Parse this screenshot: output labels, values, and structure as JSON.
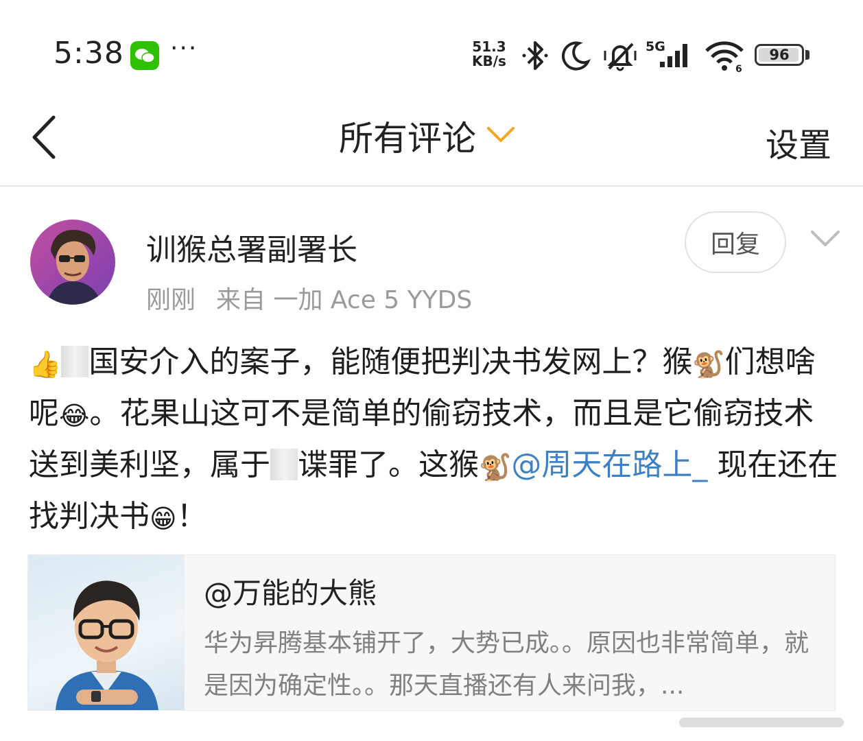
{
  "status_bar": {
    "time": "5:38",
    "more": "···",
    "net_speed_value": "51.3",
    "net_speed_unit": "KB/s",
    "signal_label": "5G",
    "wifi_label": "6",
    "battery_percent": "96",
    "battery_level": 0.96
  },
  "nav": {
    "title": "所有评论",
    "settings_label": "设置",
    "accent_color": "#f5a623"
  },
  "comment": {
    "username": "训猴总署副署长",
    "time": "刚刚",
    "source": "来自 一加 Ace 5 YYDS",
    "reply_label": "回复",
    "body": {
      "seg1": "国安介入的案子，能随便把判决书发网上？猴",
      "seg2": "们想啥呢",
      "seg3": "。花果山这可不是简单的偷窃技术，而且是它偷窃技术送到美利坚，属于",
      "seg4": "谍罪了。这猴",
      "mention": "@周天在路上_",
      "seg5": " 现在还在找判决书",
      "seg6": "！"
    },
    "link_color": "#3e80c4"
  },
  "quote": {
    "author": "@万能的大熊",
    "text": "华为昇腾基本铺开了，大势已成。。原因也非常简单，就是因为确定性。。那天直播还有人来问我，..."
  }
}
